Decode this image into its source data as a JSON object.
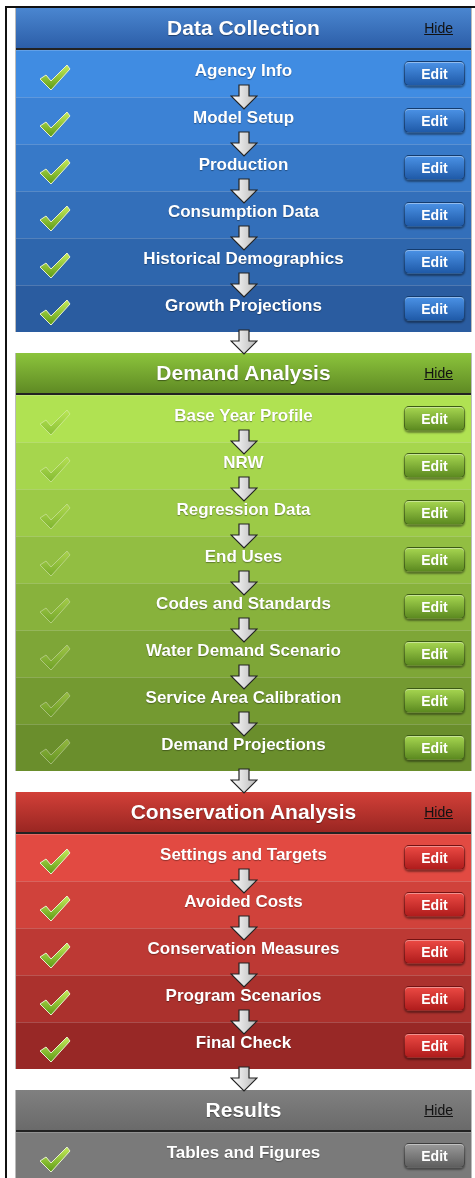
{
  "sections": [
    {
      "title": "Data Collection",
      "kind": "blue",
      "hide": "Hide",
      "steps": [
        {
          "label": "Agency Info",
          "complete": true,
          "button": "Edit"
        },
        {
          "label": "Model Setup",
          "complete": true,
          "button": "Edit"
        },
        {
          "label": "Production",
          "complete": true,
          "button": "Edit"
        },
        {
          "label": "Consumption Data",
          "complete": true,
          "button": "Edit"
        },
        {
          "label": "Historical Demographics",
          "complete": true,
          "button": "Edit"
        },
        {
          "label": "Growth Projections",
          "complete": true,
          "button": "Edit"
        }
      ]
    },
    {
      "title": "Demand Analysis",
      "kind": "green",
      "hide": "Hide",
      "steps": [
        {
          "label": "Base Year Profile",
          "complete": false,
          "button": "Edit"
        },
        {
          "label": "NRW",
          "complete": false,
          "button": "Edit"
        },
        {
          "label": "Regression Data",
          "complete": false,
          "button": "Edit"
        },
        {
          "label": "End Uses",
          "complete": false,
          "button": "Edit"
        },
        {
          "label": "Codes and Standards",
          "complete": false,
          "button": "Edit"
        },
        {
          "label": "Water Demand Scenario",
          "complete": false,
          "button": "Edit"
        },
        {
          "label": "Service Area Calibration",
          "complete": false,
          "button": "Edit"
        },
        {
          "label": "Demand Projections",
          "complete": false,
          "button": "Edit"
        }
      ]
    },
    {
      "title": "Conservation Analysis",
      "kind": "red",
      "hide": "Hide",
      "steps": [
        {
          "label": "Settings and Targets",
          "complete": true,
          "button": "Edit"
        },
        {
          "label": "Avoided Costs",
          "complete": true,
          "button": "Edit"
        },
        {
          "label": "Conservation Measures",
          "complete": true,
          "button": "Edit"
        },
        {
          "label": "Program Scenarios",
          "complete": true,
          "button": "Edit"
        },
        {
          "label": "Final Check",
          "complete": true,
          "button": "Edit"
        }
      ]
    },
    {
      "title": "Results",
      "kind": "gray",
      "hide": "Hide",
      "steps": [
        {
          "label": "Tables and Figures",
          "complete": true,
          "button": "Edit"
        }
      ]
    }
  ]
}
